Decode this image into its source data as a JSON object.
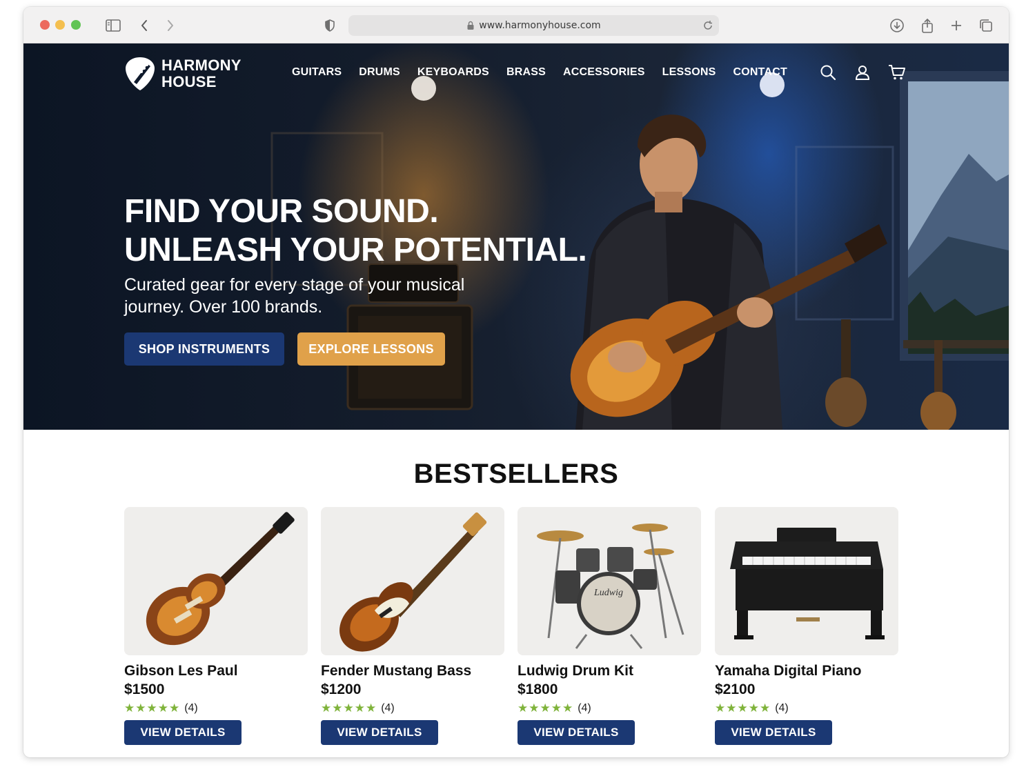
{
  "browser": {
    "url": "www.harmonyhouse.com"
  },
  "brand": {
    "line1": "HARMONY",
    "line2": "HOUSE"
  },
  "nav": [
    {
      "label": "GUITARS"
    },
    {
      "label": "DRUMS"
    },
    {
      "label": "KEYBOARDS"
    },
    {
      "label": "BRASS"
    },
    {
      "label": "ACCESSORIES"
    },
    {
      "label": "LESSONS"
    },
    {
      "label": "CONTACT"
    }
  ],
  "nav_icons": [
    "search-icon",
    "user-icon",
    "cart-icon"
  ],
  "hero": {
    "title_line1": "FIND YOUR SOUND.",
    "title_line2": "UNLEASH YOUR POTENTIAL.",
    "subtitle": "Curated gear for every stage of your musical journey. Over 100 brands.",
    "primary_button": "SHOP INSTRUMENTS",
    "secondary_button": "EXPLORE LESSONS"
  },
  "bestsellers": {
    "title": "BESTSELLERS",
    "products": [
      {
        "name": "Gibson Les Paul",
        "price": "$1500",
        "stars": "★★★★★",
        "reviews": "(4)",
        "button": "VIEW DETAILS"
      },
      {
        "name": "Fender Mustang Bass",
        "price": "$1200",
        "stars": "★★★★★",
        "reviews": "(4)",
        "button": "VIEW DETAILS"
      },
      {
        "name": "Ludwig Drum Kit",
        "price": "$1800",
        "stars": "★★★★★",
        "reviews": "(4)",
        "button": "VIEW DETAILS"
      },
      {
        "name": "Yamaha Digital Piano",
        "price": "$2100",
        "stars": "★★★★★",
        "reviews": "(4)",
        "button": "VIEW DETAILS"
      }
    ]
  },
  "colors": {
    "primary_navy": "#1b3873",
    "accent_orange": "#e0a14a",
    "star_green": "#7fb33a"
  }
}
